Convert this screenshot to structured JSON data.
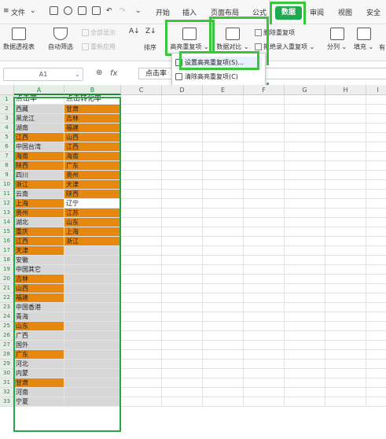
{
  "menubar": {
    "file_label": "文件",
    "tabs": [
      "开始",
      "插入",
      "页面布局",
      "公式",
      "数据",
      "审阅",
      "视图",
      "安全"
    ],
    "active_tab": "数据"
  },
  "ribbon": {
    "pivot": "数据透视表",
    "autofilter": "自动筛选",
    "show_all": "全部显示",
    "reapply": "重新应用",
    "sort": "排序",
    "highlight_dup": "高亮重复项",
    "data_compare": "数据对比",
    "remove_dup": "删除重复项",
    "reject_dup": "拒绝录入重复项",
    "split": "分列",
    "fill": "填充",
    "more": "有"
  },
  "formula_bar": {
    "name_box": "A1",
    "fx": "fx",
    "value": "点击率"
  },
  "columns": [
    "A",
    "B",
    "C",
    "D",
    "E",
    "F",
    "G",
    "H",
    "I"
  ],
  "dropdown": {
    "items": [
      "设置高亮重复项(S)...",
      "清除高亮重复项(C)"
    ]
  },
  "sheet": {
    "header_a": "点击率",
    "header_b": "点击转化率",
    "col_a": [
      "西藏",
      "黑龙江",
      "湖南",
      "江西",
      "中国台湾",
      "海南",
      "陕西",
      "四川",
      "浙江",
      "云南",
      "上海",
      "贵州",
      "湖北",
      "重庆",
      "江西",
      "天津",
      "安徽",
      "中国其它",
      "吉林",
      "山西",
      "福建",
      "中国香港",
      "青海",
      "山东",
      "广西",
      "国外",
      "广东",
      "河北",
      "内蒙",
      "甘肃",
      "河南",
      "宁夏"
    ],
    "col_a_fill": [
      "g",
      "g",
      "g",
      "o",
      "g",
      "o",
      "o",
      "g",
      "o",
      "g",
      "o",
      "o",
      "g",
      "o",
      "o",
      "o",
      "g",
      "g",
      "o",
      "o",
      "o",
      "g",
      "g",
      "o",
      "g",
      "g",
      "o",
      "g",
      "g",
      "o",
      "g",
      "g"
    ],
    "col_b": [
      "甘肃",
      "吉林",
      "福建",
      "山西",
      "江西",
      "海南",
      "广东",
      "贵州",
      "天津",
      "陕西",
      "辽宁",
      "江苏",
      "山东",
      "上海",
      "浙江",
      "",
      "",
      "",
      "",
      "",
      "",
      "",
      "",
      "",
      "",
      "",
      "",
      "",
      "",
      "",
      "",
      ""
    ],
    "col_b_fill": [
      "o",
      "o",
      "o",
      "o",
      "o",
      "o",
      "o",
      "o",
      "o",
      "o",
      "w",
      "o",
      "o",
      "o",
      "o",
      "g",
      "g",
      "g",
      "g",
      "g",
      "g",
      "g",
      "g",
      "g",
      "g",
      "g",
      "g",
      "g",
      "g",
      "g",
      "g",
      "g"
    ]
  }
}
